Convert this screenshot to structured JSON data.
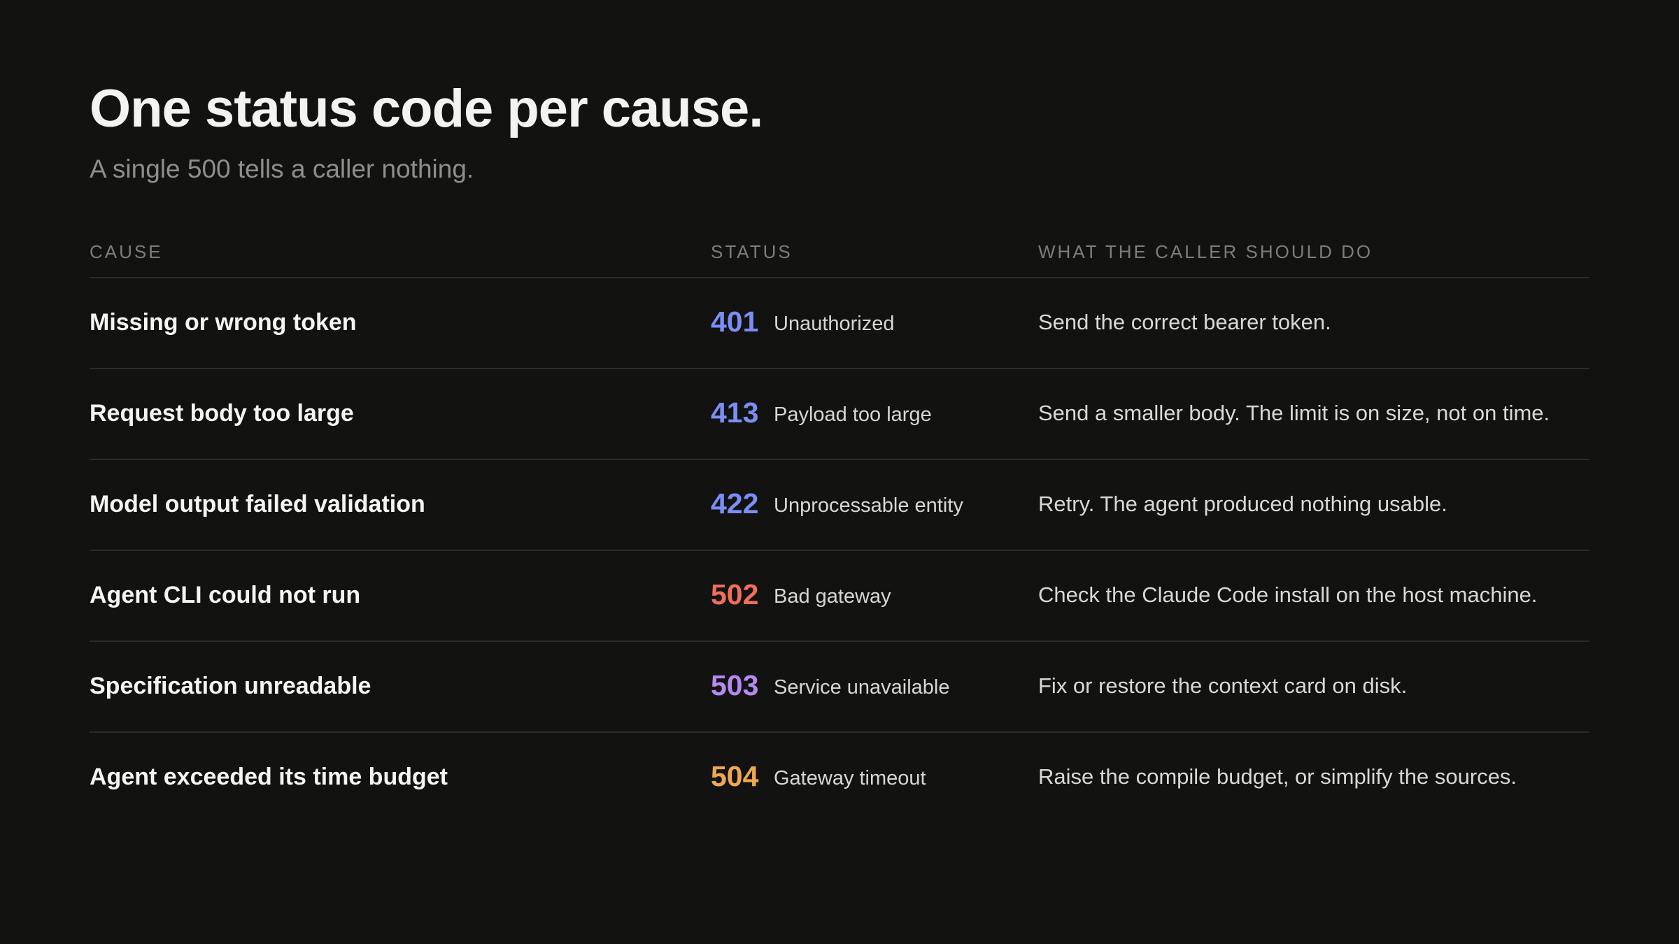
{
  "title": "One status code per cause.",
  "subtitle": "A single 500 tells a caller nothing.",
  "table": {
    "headers": {
      "cause": "CAUSE",
      "status": "STATUS",
      "action": "WHAT THE CALLER SHOULD DO"
    },
    "rows": [
      {
        "cause": "Missing or wrong token",
        "code": "401",
        "status_text": "Unauthorized",
        "action": "Send the correct bearer token.",
        "code_color": "#7b8ef5"
      },
      {
        "cause": "Request body too large",
        "code": "413",
        "status_text": "Payload too large",
        "action": "Send a smaller body. The limit is on size, not on time.",
        "code_color": "#7b8ef5"
      },
      {
        "cause": "Model output failed validation",
        "code": "422",
        "status_text": "Unprocessable entity",
        "action": "Retry. The agent produced nothing usable.",
        "code_color": "#7b8ef5"
      },
      {
        "cause": "Agent CLI could not run",
        "code": "502",
        "status_text": "Bad gateway",
        "action": "Check the Claude Code install on the host machine.",
        "code_color": "#ee6f5c"
      },
      {
        "cause": "Specification unreadable",
        "code": "503",
        "status_text": "Service unavailable",
        "action": "Fix or restore the context card on disk.",
        "code_color": "#b688f2"
      },
      {
        "cause": "Agent exceeded its time budget",
        "code": "504",
        "status_text": "Gateway timeout",
        "action": "Raise the compile budget, or simplify the sources.",
        "code_color": "#eda94f"
      }
    ]
  }
}
